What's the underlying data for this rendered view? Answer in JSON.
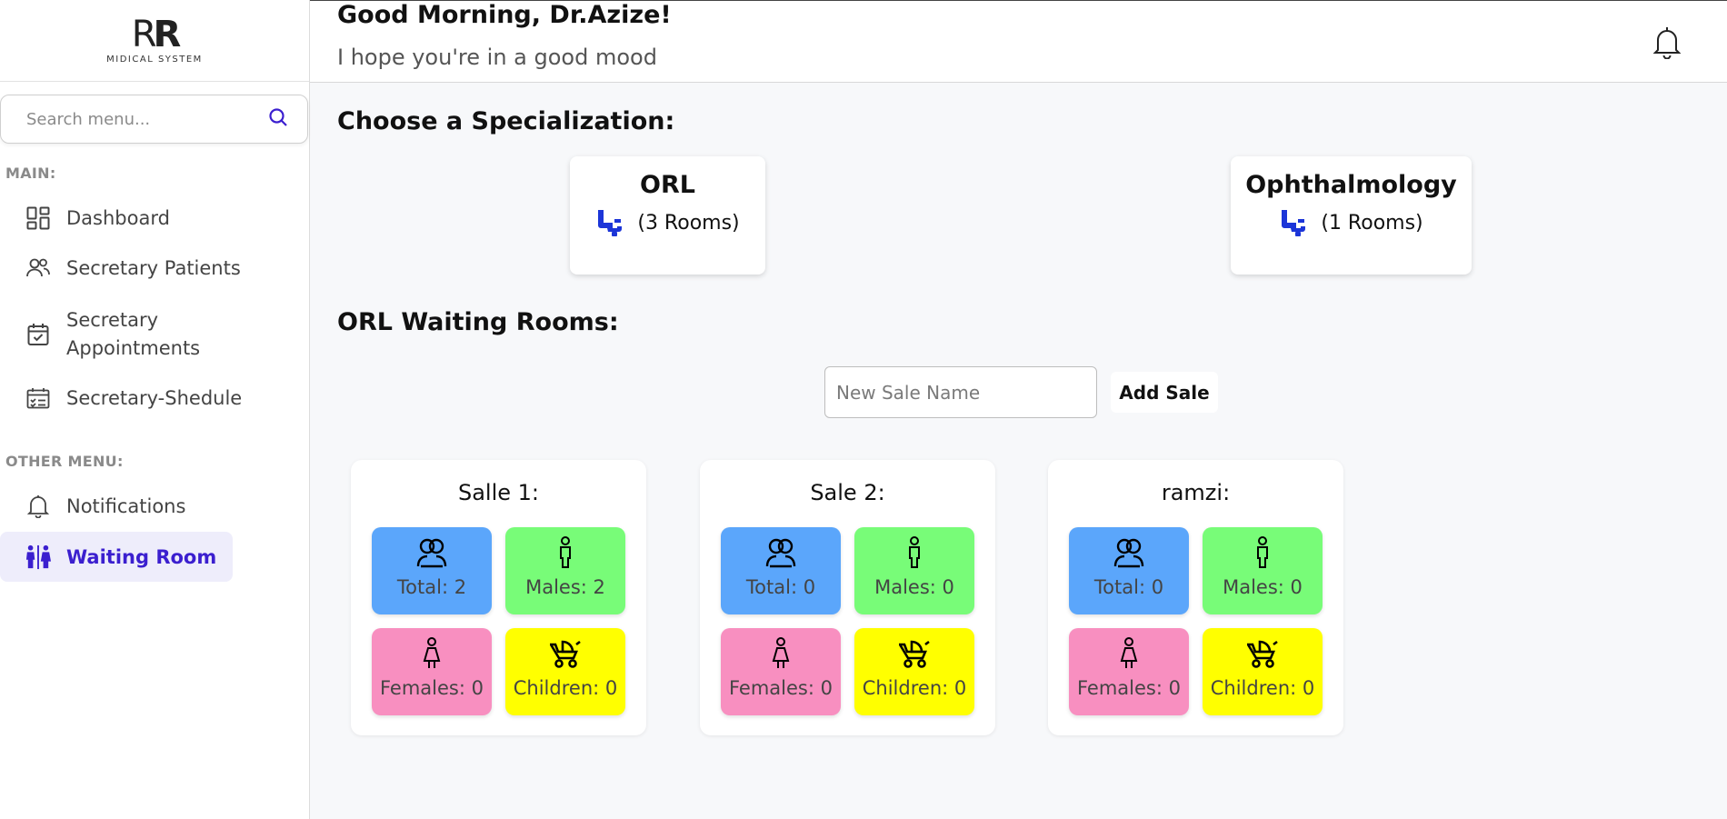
{
  "brand": {
    "mark_left": "R",
    "mark_right": "R",
    "subtitle": "MIDICAL SYSTEM"
  },
  "search": {
    "placeholder": "Search menu..."
  },
  "sidebar": {
    "main_label": "MAIN:",
    "main_items": [
      {
        "label": "Dashboard",
        "icon": "dashboard-icon"
      },
      {
        "label": "Secretary Patients",
        "icon": "users-icon"
      },
      {
        "label": "Secretary\nAppointments",
        "icon": "calendar-check-icon"
      },
      {
        "label": "Secretary-Shedule",
        "icon": "schedule-icon"
      }
    ],
    "other_label": "OTHER MENU:",
    "other_items": [
      {
        "label": "Notifications",
        "icon": "bell-icon"
      },
      {
        "label": "Waiting Room",
        "icon": "restroom-icon",
        "active": true
      }
    ]
  },
  "header": {
    "greeting": "Good Morning, Dr.Azize!",
    "subtitle": "I hope you're in a good mood"
  },
  "main": {
    "spec_heading": "Choose a Specialization:",
    "specializations": [
      {
        "name": "ORL",
        "rooms": "(3 Rooms)"
      },
      {
        "name": "Ophthalmology",
        "rooms": "(1 Rooms)"
      }
    ],
    "rooms_heading": "ORL Waiting Rooms:",
    "new_sale_placeholder": "New Sale Name",
    "add_sale_label": "Add Sale",
    "rooms": [
      {
        "title": "Salle 1:",
        "total": "Total: 2",
        "males": "Males: 2",
        "females": "Females: 0",
        "children": "Children: 0"
      },
      {
        "title": "Sale 2:",
        "total": "Total: 0",
        "males": "Males: 0",
        "females": "Females: 0",
        "children": "Children: 0"
      },
      {
        "title": "ramzi:",
        "total": "Total: 0",
        "males": "Males: 0",
        "females": "Females: 0",
        "children": "Children: 0"
      }
    ]
  },
  "colors": {
    "accent": "#3b1fcf",
    "total": "#5ba6fb",
    "males": "#78fc78",
    "females": "#f88fc0",
    "children": "#ffff00",
    "seat_icon": "#1c35d8"
  }
}
